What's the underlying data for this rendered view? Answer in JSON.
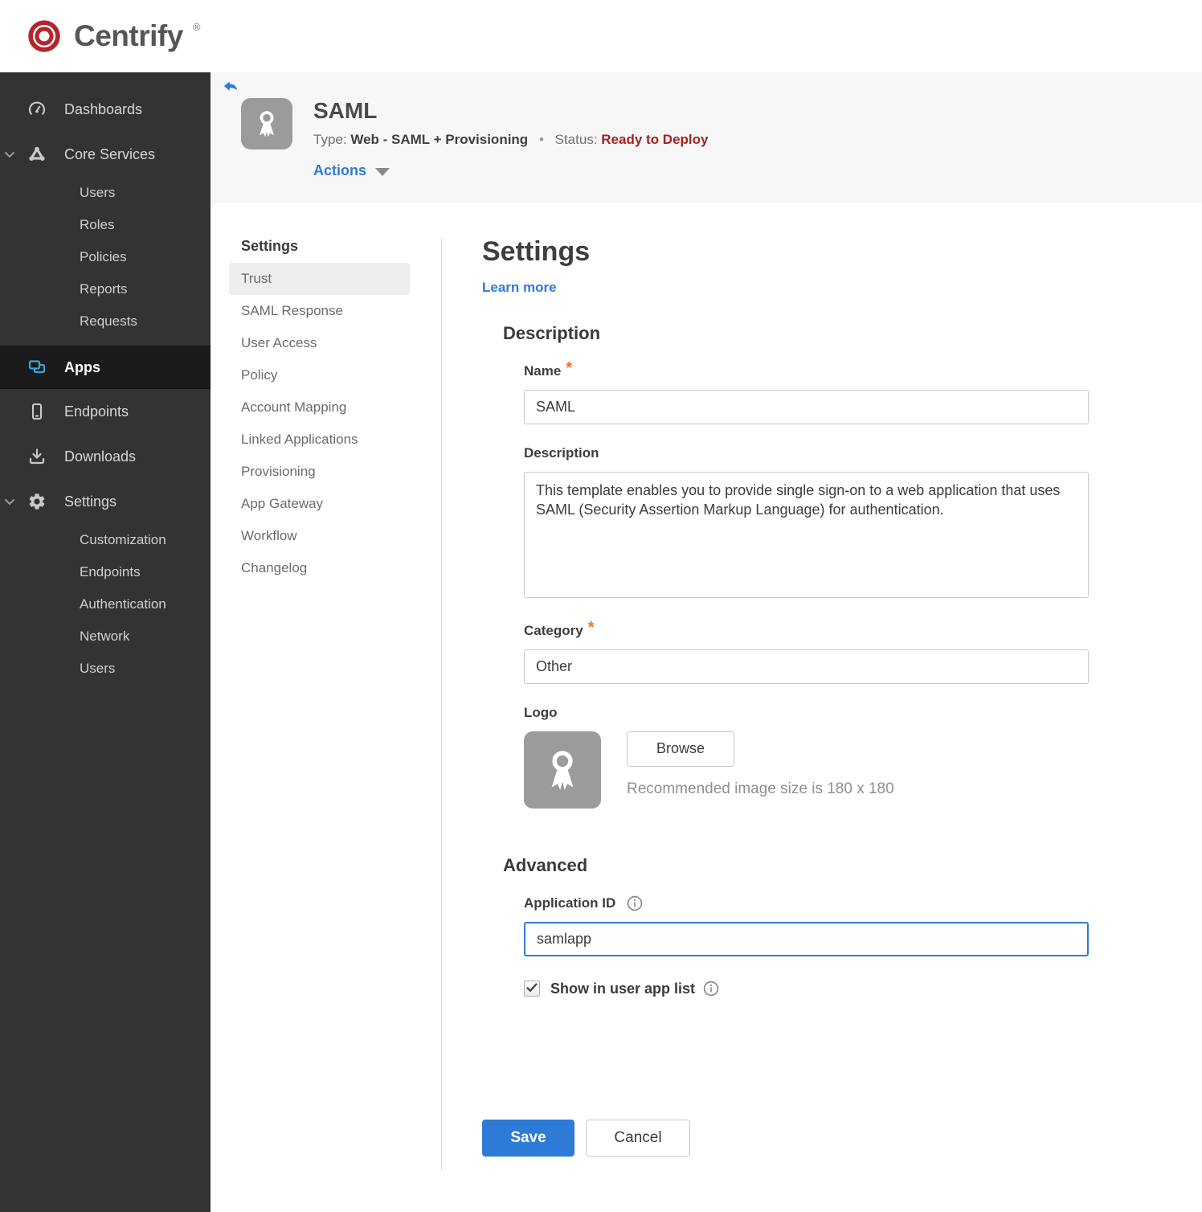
{
  "brand": {
    "name": "Centrify",
    "registered_mark": "®"
  },
  "colors": {
    "accent_blue": "#2D7BD6",
    "status_red": "#A32222",
    "required_orange": "#EE7623",
    "apps_icon_blue": "#3BA2DE",
    "sidebar_bg": "#333333",
    "header_bg": "#F7F7F7"
  },
  "sidebar": {
    "items": [
      {
        "label": "Dashboards"
      },
      {
        "label": "Core Services"
      },
      {
        "label": "Users"
      },
      {
        "label": "Roles"
      },
      {
        "label": "Policies"
      },
      {
        "label": "Reports"
      },
      {
        "label": "Requests"
      },
      {
        "label": "Apps"
      },
      {
        "label": "Endpoints"
      },
      {
        "label": "Downloads"
      },
      {
        "label": "Settings"
      },
      {
        "label": "Customization"
      },
      {
        "label": "Endpoints"
      },
      {
        "label": "Authentication"
      },
      {
        "label": "Network"
      },
      {
        "label": "Users"
      }
    ],
    "active_item": "Apps"
  },
  "header": {
    "title": "SAML",
    "type_label": "Type:",
    "type_value": "Web - SAML + Provisioning",
    "separator": "•",
    "status_label": "Status:",
    "status_value": "Ready to Deploy",
    "actions_label": "Actions"
  },
  "subnav": {
    "heading": "Settings",
    "active_item": "Trust",
    "items": [
      "Trust",
      "SAML Response",
      "User Access",
      "Policy",
      "Account Mapping",
      "Linked Applications",
      "Provisioning",
      "App Gateway",
      "Workflow",
      "Changelog"
    ]
  },
  "main": {
    "heading": "Settings",
    "learn_more_label": "Learn more",
    "required_marker": "*",
    "description_section_title": "Description",
    "fields": {
      "name_label": "Name",
      "name_value": "SAML",
      "description_label": "Description",
      "description_value": "This template enables you to provide single sign-on to a web application that uses SAML (Security Assertion Markup Language) for authentication.",
      "category_label": "Category",
      "category_value": "Other",
      "logo_label": "Logo",
      "browse_button_label": "Browse",
      "logo_hint": "Recommended image size is 180 x 180"
    },
    "advanced_section_title": "Advanced",
    "advanced": {
      "application_id_label": "Application ID",
      "application_id_value": "samlapp",
      "show_in_user_app_list_label": "Show in user app list",
      "checkbox_checked": true
    },
    "footer": {
      "save_label": "Save",
      "cancel_label": "Cancel"
    }
  }
}
